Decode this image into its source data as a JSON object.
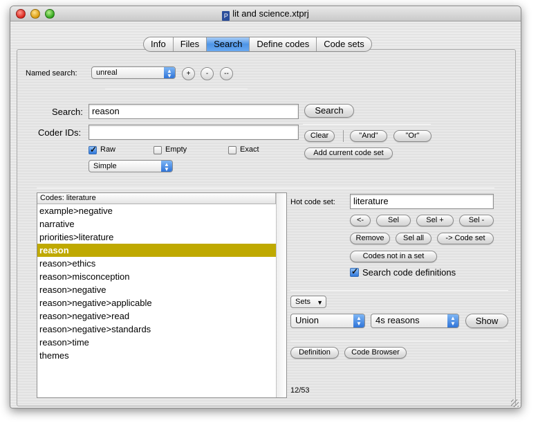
{
  "window": {
    "title": "lit and science.xtprj",
    "doc_icon": "P"
  },
  "tabs": [
    {
      "label": "Info"
    },
    {
      "label": "Files"
    },
    {
      "label": "Search"
    },
    {
      "label": "Define codes"
    },
    {
      "label": "Code sets"
    }
  ],
  "named_search": {
    "label": "Named search:",
    "value": "unreal",
    "add": "+",
    "remove": "-",
    "clear": "--"
  },
  "search": {
    "label": "Search:",
    "value": "reason",
    "button": "Search",
    "coder_ids_label": "Coder IDs:",
    "coder_ids_value": "",
    "clear": "Clear",
    "and": "\"And\"",
    "or": "\"Or\"",
    "add_code_set": "Add current code set",
    "raw": "Raw",
    "empty": "Empty",
    "exact": "Exact",
    "mode": "Simple"
  },
  "codes": {
    "header": "Codes: literature",
    "items": [
      "example>negative",
      "narrative",
      "priorities>literature",
      "reason",
      "reason>ethics",
      "reason>misconception",
      "reason>negative",
      "reason>negative>applicable",
      "reason>negative>read",
      "reason>negative>standards",
      "reason>time",
      "themes"
    ],
    "selected_index": 3,
    "count": "12/53"
  },
  "hot": {
    "label": "Hot code set:",
    "value": "literature",
    "back": "<-",
    "sel": "Sel",
    "sel_plus": "Sel +",
    "sel_minus": "Sel -",
    "remove": "Remove",
    "sel_all": "Sel all",
    "to_code_set": "-> Code set",
    "codes_not_in_set": "Codes not in a set",
    "search_defs": "Search code definitions"
  },
  "sets": {
    "label": "Sets",
    "op": "Union",
    "set": "4s reasons",
    "show": "Show"
  },
  "bottom": {
    "definition": "Definition",
    "code_browser": "Code Browser"
  },
  "colors": {
    "selection": "#bfa900",
    "accent": "#4f95e6"
  }
}
